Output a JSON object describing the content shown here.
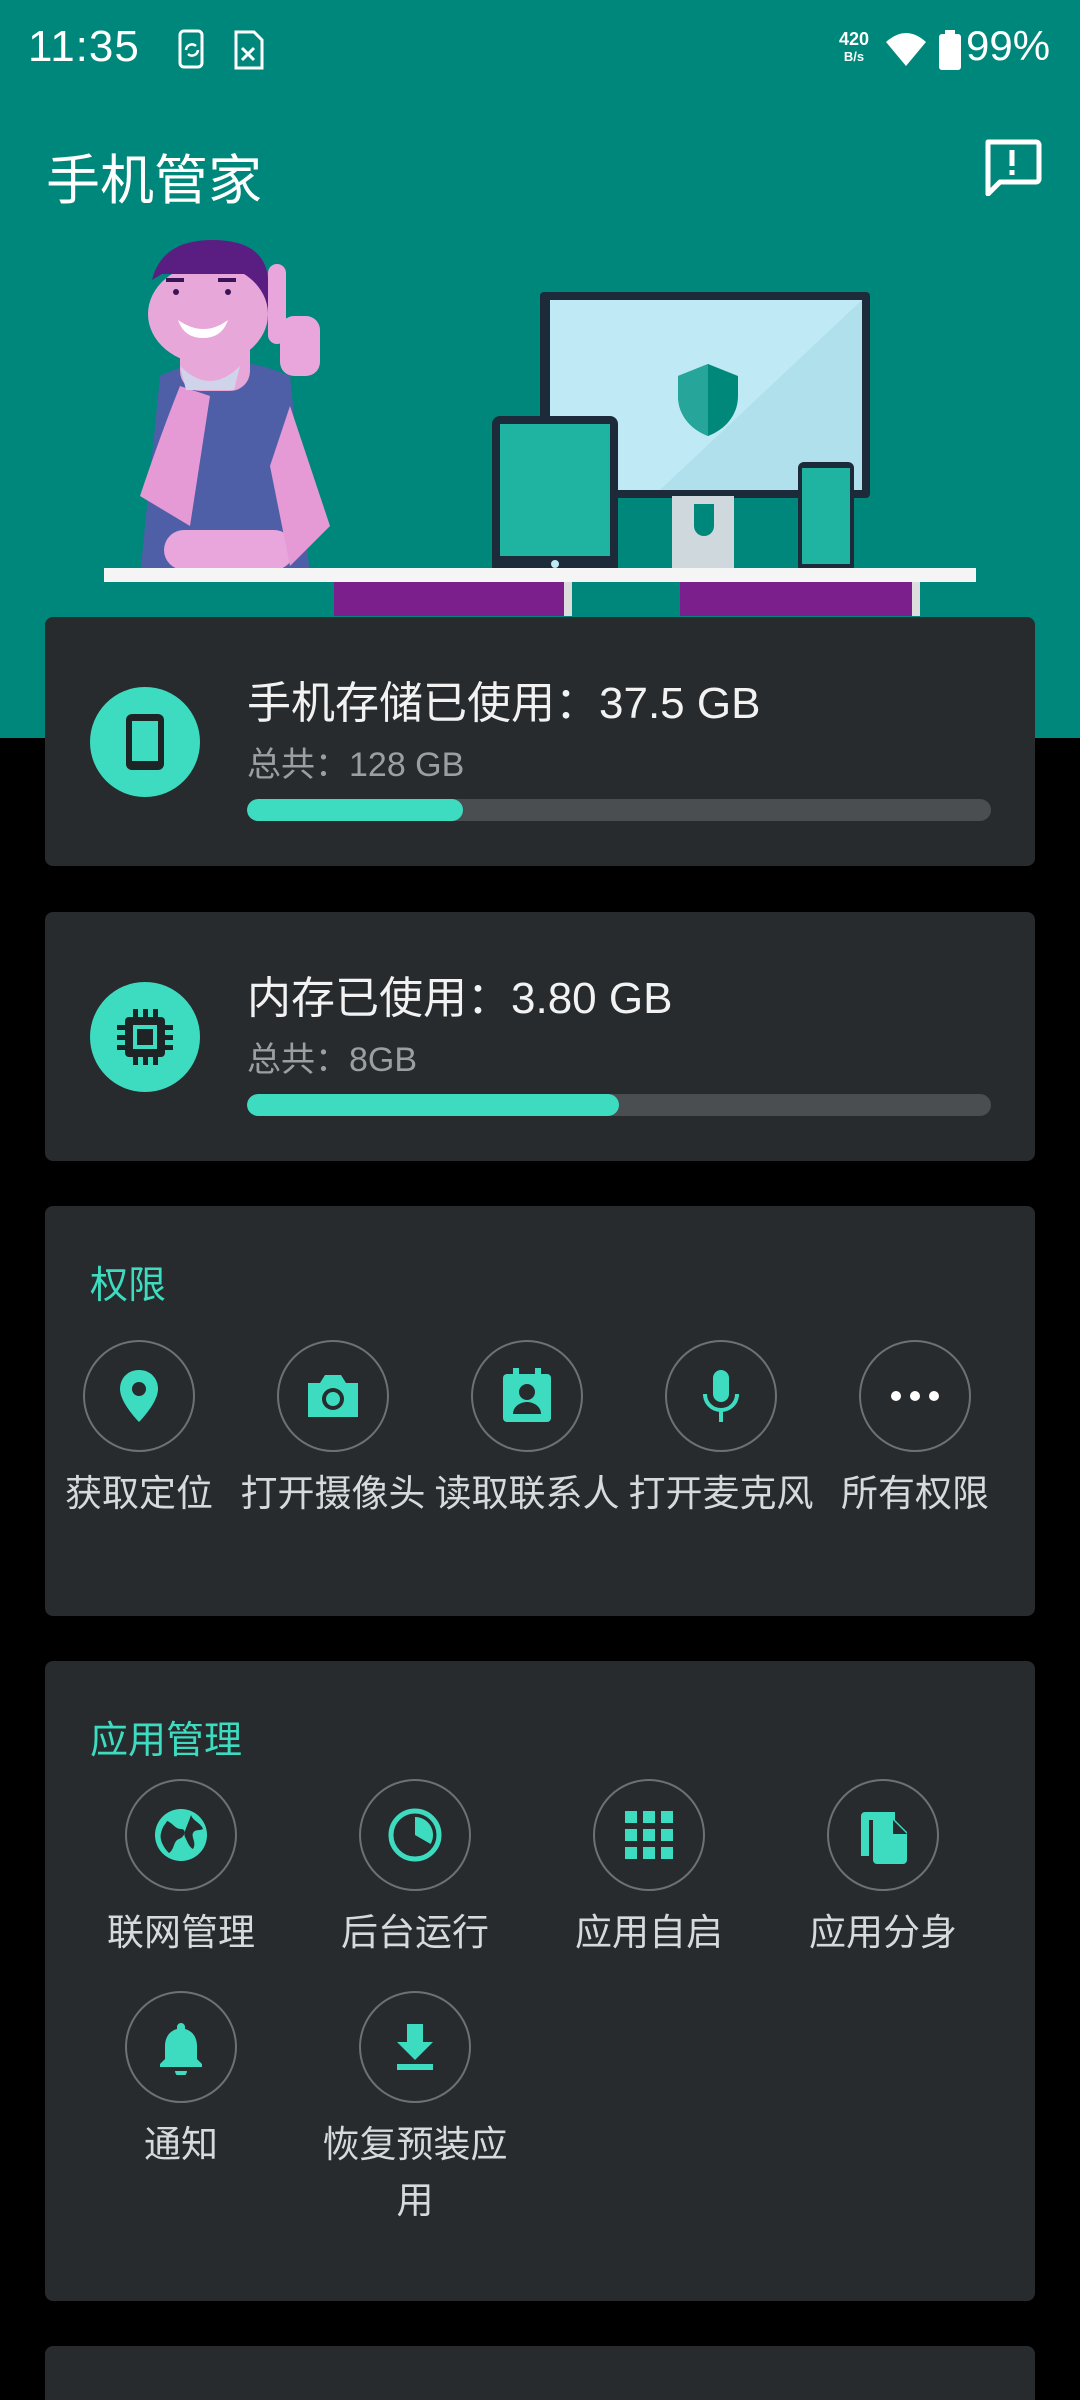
{
  "status_bar": {
    "time": "11:35",
    "net_speed_value": "420",
    "net_speed_unit": "B/s",
    "battery": "99%"
  },
  "app": {
    "title": "手机管家"
  },
  "storage": {
    "used_label": "手机存储已使用：37.5 GB",
    "total_label": "总共：128 GB",
    "used_fraction": 0.29
  },
  "memory": {
    "used_label": "内存已使用：3.80 GB",
    "total_label": "总共：8GB",
    "used_fraction": 0.5
  },
  "permissions": {
    "title": "权限",
    "items": [
      {
        "label": "获取定位",
        "icon": "location-icon"
      },
      {
        "label": "打开摄像头",
        "icon": "camera-icon"
      },
      {
        "label": "读取联系人",
        "icon": "contacts-icon"
      },
      {
        "label": "打开麦克风",
        "icon": "microphone-icon"
      },
      {
        "label": "所有权限",
        "icon": "more-icon"
      }
    ]
  },
  "app_management": {
    "title": "应用管理",
    "items": [
      {
        "label": "联网管理",
        "icon": "globe-icon"
      },
      {
        "label": "后台运行",
        "icon": "pie-chart-icon"
      },
      {
        "label": "应用自启",
        "icon": "apps-grid-icon"
      },
      {
        "label": "应用分身",
        "icon": "copy-icon"
      },
      {
        "label": "通知",
        "icon": "bell-icon"
      },
      {
        "label": "恢复预装应用",
        "icon": "download-icon"
      }
    ]
  },
  "colors": {
    "header_teal": "#00877b",
    "accent": "#3ddcc0",
    "card_bg": "#272b2e"
  }
}
